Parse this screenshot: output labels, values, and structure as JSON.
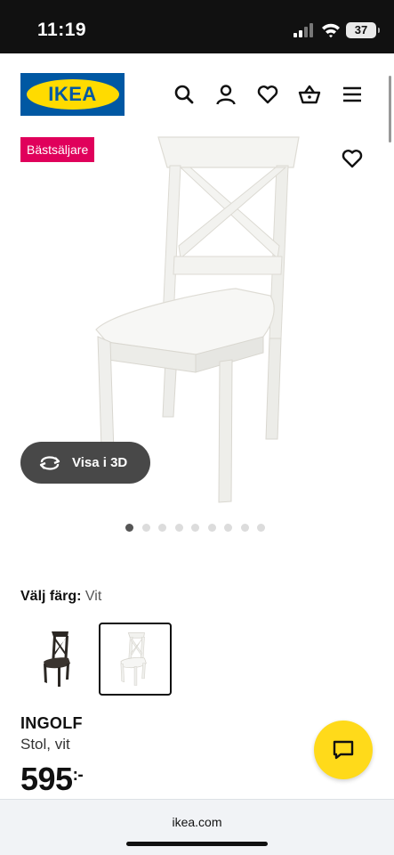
{
  "status_bar": {
    "time": "11:19",
    "battery": "37"
  },
  "header": {
    "logo_text": "IKEA",
    "icons": [
      "search-icon",
      "account-icon",
      "wishlist-icon",
      "cart-icon",
      "menu-icon"
    ]
  },
  "product": {
    "badge": "Bästsäljare",
    "view_3d_label": "Visa i 3D",
    "image_count": 9,
    "active_image": 1,
    "color_label": "Välj färg:",
    "color_value": "Vit",
    "swatches": [
      {
        "color": "black-brown",
        "selected": false
      },
      {
        "color": "white",
        "selected": true
      }
    ],
    "name": "INGOLF",
    "description": "Stol, vit",
    "price": "595",
    "price_suffix": ":-"
  },
  "browser": {
    "url": "ikea.com"
  },
  "colors": {
    "ikea_blue": "#0058a3",
    "ikea_yellow": "#ffdb00",
    "badge": "#e0005b",
    "chat": "#ffda1a"
  }
}
